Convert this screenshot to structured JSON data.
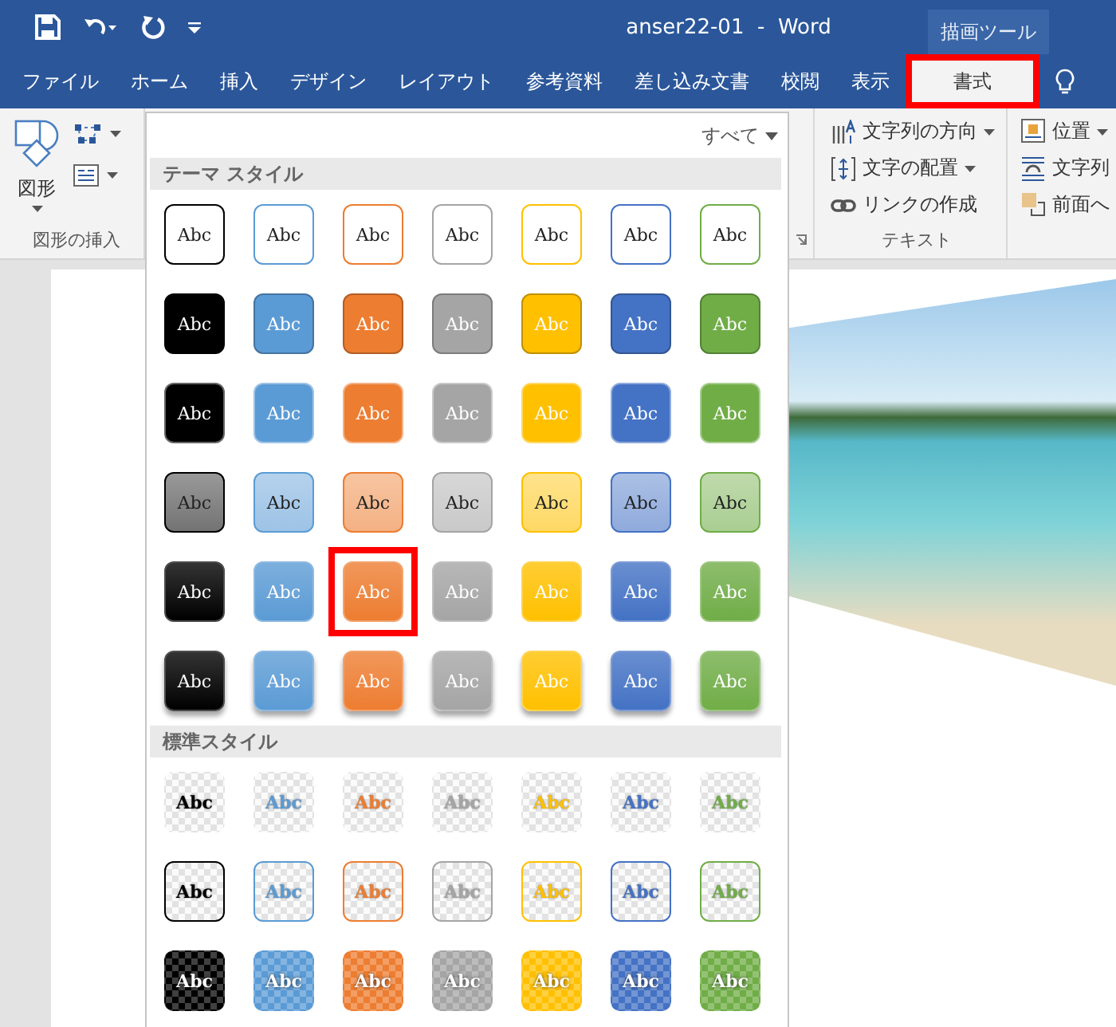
{
  "window": {
    "title": "anser22-01  -  Word",
    "context_tab": "描画ツール"
  },
  "tabs": [
    {
      "label": "ファイル",
      "selected": false,
      "highlighted": false
    },
    {
      "label": "ホーム",
      "selected": false,
      "highlighted": false
    },
    {
      "label": "挿入",
      "selected": false,
      "highlighted": false
    },
    {
      "label": "デザイン",
      "selected": false,
      "highlighted": false
    },
    {
      "label": "レイアウト",
      "selected": false,
      "highlighted": false
    },
    {
      "label": "参考資料",
      "selected": false,
      "highlighted": false
    },
    {
      "label": "差し込み文書",
      "selected": false,
      "highlighted": false
    },
    {
      "label": "校閲",
      "selected": false,
      "highlighted": false
    },
    {
      "label": "表示",
      "selected": false,
      "highlighted": false
    },
    {
      "label": "書式",
      "selected": true,
      "highlighted": true
    }
  ],
  "ribbon": {
    "shapes_group": {
      "button": "図形",
      "name": "図形の挿入"
    },
    "text_group": {
      "name": "テキスト",
      "items": [
        {
          "label": "文字列の方向",
          "dropdown": true
        },
        {
          "label": "文字の配置",
          "dropdown": true
        },
        {
          "label": "リンクの作成",
          "dropdown": false
        }
      ]
    },
    "arrange_group": {
      "items": [
        {
          "label": "位置",
          "dropdown": true
        },
        {
          "label": "文字列"
        },
        {
          "label": "前面へ"
        }
      ]
    }
  },
  "gallery": {
    "filter": "すべて",
    "sections": [
      {
        "title": "テーマ スタイル",
        "rows": [
          {
            "kind": "outline",
            "swatches": [
              {
                "label": "Abc",
                "color": "#000000",
                "highlighted": false
              },
              {
                "label": "Abc",
                "color": "#5b9bd5",
                "highlighted": false
              },
              {
                "label": "Abc",
                "color": "#ed7d31",
                "highlighted": false
              },
              {
                "label": "Abc",
                "color": "#a5a5a5",
                "highlighted": false
              },
              {
                "label": "Abc",
                "color": "#ffc000",
                "highlighted": false
              },
              {
                "label": "Abc",
                "color": "#4472c4",
                "highlighted": false
              },
              {
                "label": "Abc",
                "color": "#70ad47",
                "highlighted": false
              }
            ]
          },
          {
            "kind": "fill",
            "swatches": [
              {
                "label": "Abc",
                "color": "#000000",
                "highlighted": false
              },
              {
                "label": "Abc",
                "color": "#5b9bd5",
                "highlighted": false
              },
              {
                "label": "Abc",
                "color": "#ed7d31",
                "highlighted": false
              },
              {
                "label": "Abc",
                "color": "#a5a5a5",
                "highlighted": false
              },
              {
                "label": "Abc",
                "color": "#ffc000",
                "highlighted": false
              },
              {
                "label": "Abc",
                "color": "#4472c4",
                "highlighted": false
              },
              {
                "label": "Abc",
                "color": "#70ad47",
                "highlighted": false
              }
            ]
          },
          {
            "kind": "fill_light_border",
            "swatches": [
              {
                "label": "Abc",
                "color": "#000000",
                "highlighted": false
              },
              {
                "label": "Abc",
                "color": "#5b9bd5",
                "highlighted": false
              },
              {
                "label": "Abc",
                "color": "#ed7d31",
                "highlighted": false
              },
              {
                "label": "Abc",
                "color": "#a5a5a5",
                "highlighted": false
              },
              {
                "label": "Abc",
                "color": "#ffc000",
                "highlighted": false
              },
              {
                "label": "Abc",
                "color": "#4472c4",
                "highlighted": false
              },
              {
                "label": "Abc",
                "color": "#70ad47",
                "highlighted": false
              }
            ]
          },
          {
            "kind": "tint",
            "swatches": [
              {
                "label": "Abc",
                "color": "#000000",
                "highlighted": false
              },
              {
                "label": "Abc",
                "color": "#5b9bd5",
                "highlighted": false
              },
              {
                "label": "Abc",
                "color": "#ed7d31",
                "highlighted": false
              },
              {
                "label": "Abc",
                "color": "#a5a5a5",
                "highlighted": false
              },
              {
                "label": "Abc",
                "color": "#ffc000",
                "highlighted": false
              },
              {
                "label": "Abc",
                "color": "#4472c4",
                "highlighted": false
              },
              {
                "label": "Abc",
                "color": "#70ad47",
                "highlighted": false
              }
            ]
          },
          {
            "kind": "gradient",
            "swatches": [
              {
                "label": "Abc",
                "color": "#000000",
                "highlighted": false
              },
              {
                "label": "Abc",
                "color": "#5b9bd5",
                "highlighted": false
              },
              {
                "label": "Abc",
                "color": "#ed7d31",
                "highlighted": true
              },
              {
                "label": "Abc",
                "color": "#a5a5a5",
                "highlighted": false
              },
              {
                "label": "Abc",
                "color": "#ffc000",
                "highlighted": false
              },
              {
                "label": "Abc",
                "color": "#4472c4",
                "highlighted": false
              },
              {
                "label": "Abc",
                "color": "#70ad47",
                "highlighted": false
              }
            ]
          },
          {
            "kind": "gradient_shadow",
            "swatches": [
              {
                "label": "Abc",
                "color": "#000000",
                "highlighted": false
              },
              {
                "label": "Abc",
                "color": "#5b9bd5",
                "highlighted": false
              },
              {
                "label": "Abc",
                "color": "#ed7d31",
                "highlighted": false
              },
              {
                "label": "Abc",
                "color": "#a5a5a5",
                "highlighted": false
              },
              {
                "label": "Abc",
                "color": "#ffc000",
                "highlighted": false
              },
              {
                "label": "Abc",
                "color": "#4472c4",
                "highlighted": false
              },
              {
                "label": "Abc",
                "color": "#70ad47",
                "highlighted": false
              }
            ]
          }
        ]
      },
      {
        "title": "標準スタイル",
        "rows": [
          {
            "kind": "text_only",
            "swatches": [
              {
                "label": "Abc",
                "color": "#000000",
                "highlighted": false
              },
              {
                "label": "Abc",
                "color": "#5b9bd5",
                "highlighted": false
              },
              {
                "label": "Abc",
                "color": "#ed7d31",
                "highlighted": false
              },
              {
                "label": "Abc",
                "color": "#a5a5a5",
                "highlighted": false
              },
              {
                "label": "Abc",
                "color": "#ffc000",
                "highlighted": false
              },
              {
                "label": "Abc",
                "color": "#4472c4",
                "highlighted": false
              },
              {
                "label": "Abc",
                "color": "#70ad47",
                "highlighted": false
              }
            ]
          },
          {
            "kind": "outline_clear",
            "swatches": [
              {
                "label": "Abc",
                "color": "#000000",
                "highlighted": false
              },
              {
                "label": "Abc",
                "color": "#5b9bd5",
                "highlighted": false
              },
              {
                "label": "Abc",
                "color": "#ed7d31",
                "highlighted": false
              },
              {
                "label": "Abc",
                "color": "#a5a5a5",
                "highlighted": false
              },
              {
                "label": "Abc",
                "color": "#ffc000",
                "highlighted": false
              },
              {
                "label": "Abc",
                "color": "#4472c4",
                "highlighted": false
              },
              {
                "label": "Abc",
                "color": "#70ad47",
                "highlighted": false
              }
            ]
          },
          {
            "kind": "translucent",
            "swatches": [
              {
                "label": "Abc",
                "color": "#000000",
                "highlighted": false
              },
              {
                "label": "Abc",
                "color": "#5b9bd5",
                "highlighted": false
              },
              {
                "label": "Abc",
                "color": "#ed7d31",
                "highlighted": false
              },
              {
                "label": "Abc",
                "color": "#a5a5a5",
                "highlighted": false
              },
              {
                "label": "Abc",
                "color": "#ffc000",
                "highlighted": false
              },
              {
                "label": "Abc",
                "color": "#4472c4",
                "highlighted": false
              },
              {
                "label": "Abc",
                "color": "#70ad47",
                "highlighted": false
              }
            ]
          }
        ]
      }
    ]
  }
}
